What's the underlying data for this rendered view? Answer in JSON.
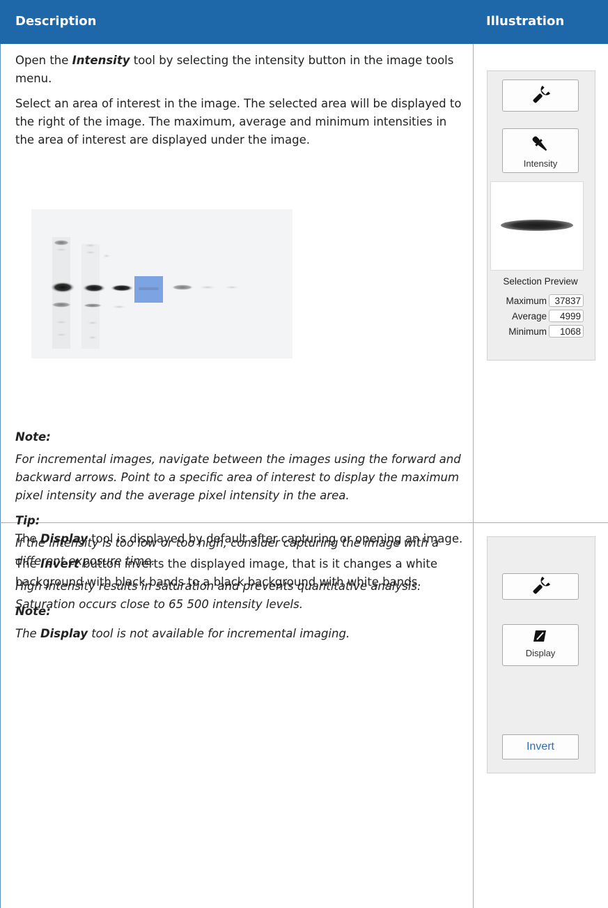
{
  "header": {
    "description": "Description",
    "illustration": "Illustration"
  },
  "row1": {
    "p1": {
      "pre": "Open the ",
      "tool": "Intensity",
      "post": " tool by selecting the intensity button in the image tools menu."
    },
    "p2": "Select an area of interest in the image. The selected area will be displayed to the right of the image. The maximum, average and minimum intensities in the area of interest are displayed under the image.",
    "note_heading": "Note:",
    "note_text": "For incremental images, navigate between the images using the forward and backward arrows. Point to a specific area of interest to display the maximum pixel intensity and the average pixel intensity in the area.",
    "tip_heading": "Tip:",
    "tip_text1": "If the intensity is too low or too high, consider capturing the image with a different exposure time.",
    "tip_text2": "High intensity results in saturation and prevents quantitative analysis. Saturation occurs close to 65 500 intensity levels.",
    "panel": {
      "tool_button_label": "Intensity",
      "preview_caption": "Selection Preview",
      "stats": [
        {
          "label": "Maximum",
          "value": "37837"
        },
        {
          "label": "Average",
          "value": "4999"
        },
        {
          "label": "Minimum",
          "value": "1068"
        }
      ]
    }
  },
  "row2": {
    "p1": {
      "pre": "The ",
      "tool": "Display",
      "post": " tool is displayed by default after capturing or opening an image."
    },
    "p2": {
      "pre": "The ",
      "tool": "Invert",
      "post": " button inverts the displayed image, that is it changes a white background with black bands to a black background with white bands."
    },
    "note_heading": "Note:",
    "note": {
      "pre": "The ",
      "tool": "Display",
      "post": " tool is not available for incremental imaging."
    },
    "panel": {
      "tool_button_label": "Display",
      "invert_label": "Invert"
    }
  }
}
